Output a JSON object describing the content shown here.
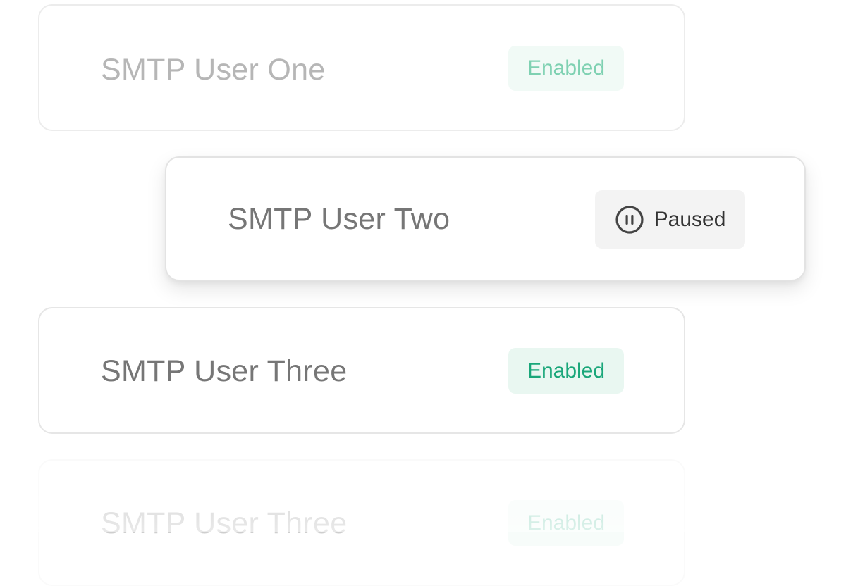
{
  "cards": [
    {
      "name": "SMTP User One",
      "status": "Enabled",
      "state": "faded"
    },
    {
      "name": "SMTP User Two",
      "status": "Paused",
      "status_icon": "pause-circle-icon",
      "state": "dragging"
    },
    {
      "name": "SMTP User Three",
      "status": "Enabled",
      "state": "normal"
    },
    {
      "name": "SMTP User Three",
      "status": "Enabled",
      "state": "faded"
    }
  ],
  "colors": {
    "enabled_text": "#1aa77a",
    "enabled_bg": "#e9f7f1",
    "paused_bg": "#f3f3f3",
    "name_text": "#767676"
  }
}
